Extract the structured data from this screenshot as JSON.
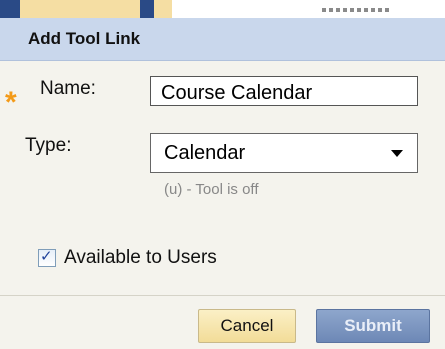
{
  "dialog": {
    "title": "Add Tool Link"
  },
  "form": {
    "required_marker": "*",
    "name_label": "Name:",
    "name_value": "Course Calendar",
    "type_label": "Type:",
    "type_value": "Calendar",
    "type_hint": "(u) - Tool is off",
    "available_label": "Available to Users",
    "available_checked": true
  },
  "buttons": {
    "cancel_label": "Cancel",
    "submit_label": "Submit"
  },
  "colors": {
    "title_bar": "#c9d7ec",
    "required_star": "#f39a18",
    "submit": "#7690bc",
    "cancel": "#f5e4ad"
  }
}
